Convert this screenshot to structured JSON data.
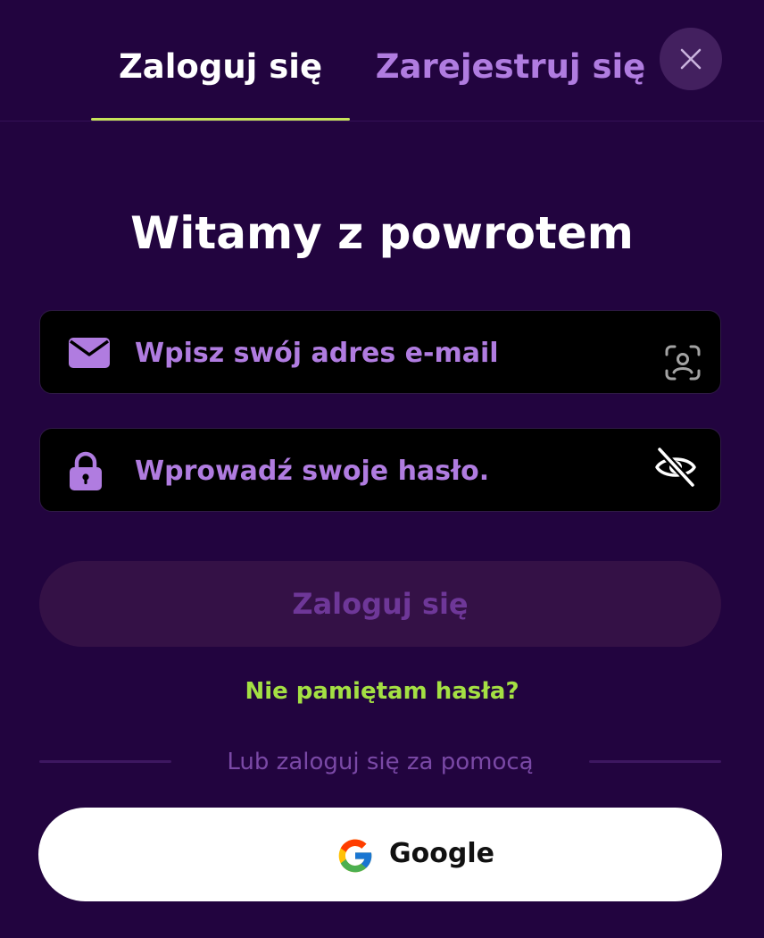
{
  "tabs": {
    "login_label": "Zaloguj się",
    "register_label": "Zarejestruj się"
  },
  "heading": "Witamy z powrotem",
  "email": {
    "value": "",
    "placeholder": "Wpisz swój adres e-mail",
    "icon": "envelope-icon",
    "trailing_icon": "face-scan-icon"
  },
  "password": {
    "value": "",
    "placeholder": "Wprowadź swoje hasło.",
    "icon": "lock-icon",
    "trailing_icon": "eye-off-icon"
  },
  "submit_label": "Zaloguj się",
  "forgot_label": "Nie pamiętam hasła?",
  "divider_text": "Lub zaloguj się za pomocą",
  "google_label": "Google",
  "colors": {
    "background": "#22043f",
    "accent_green": "#a4e043",
    "tab_underline": "#c6e35a",
    "purple_text": "#b07ce0"
  }
}
